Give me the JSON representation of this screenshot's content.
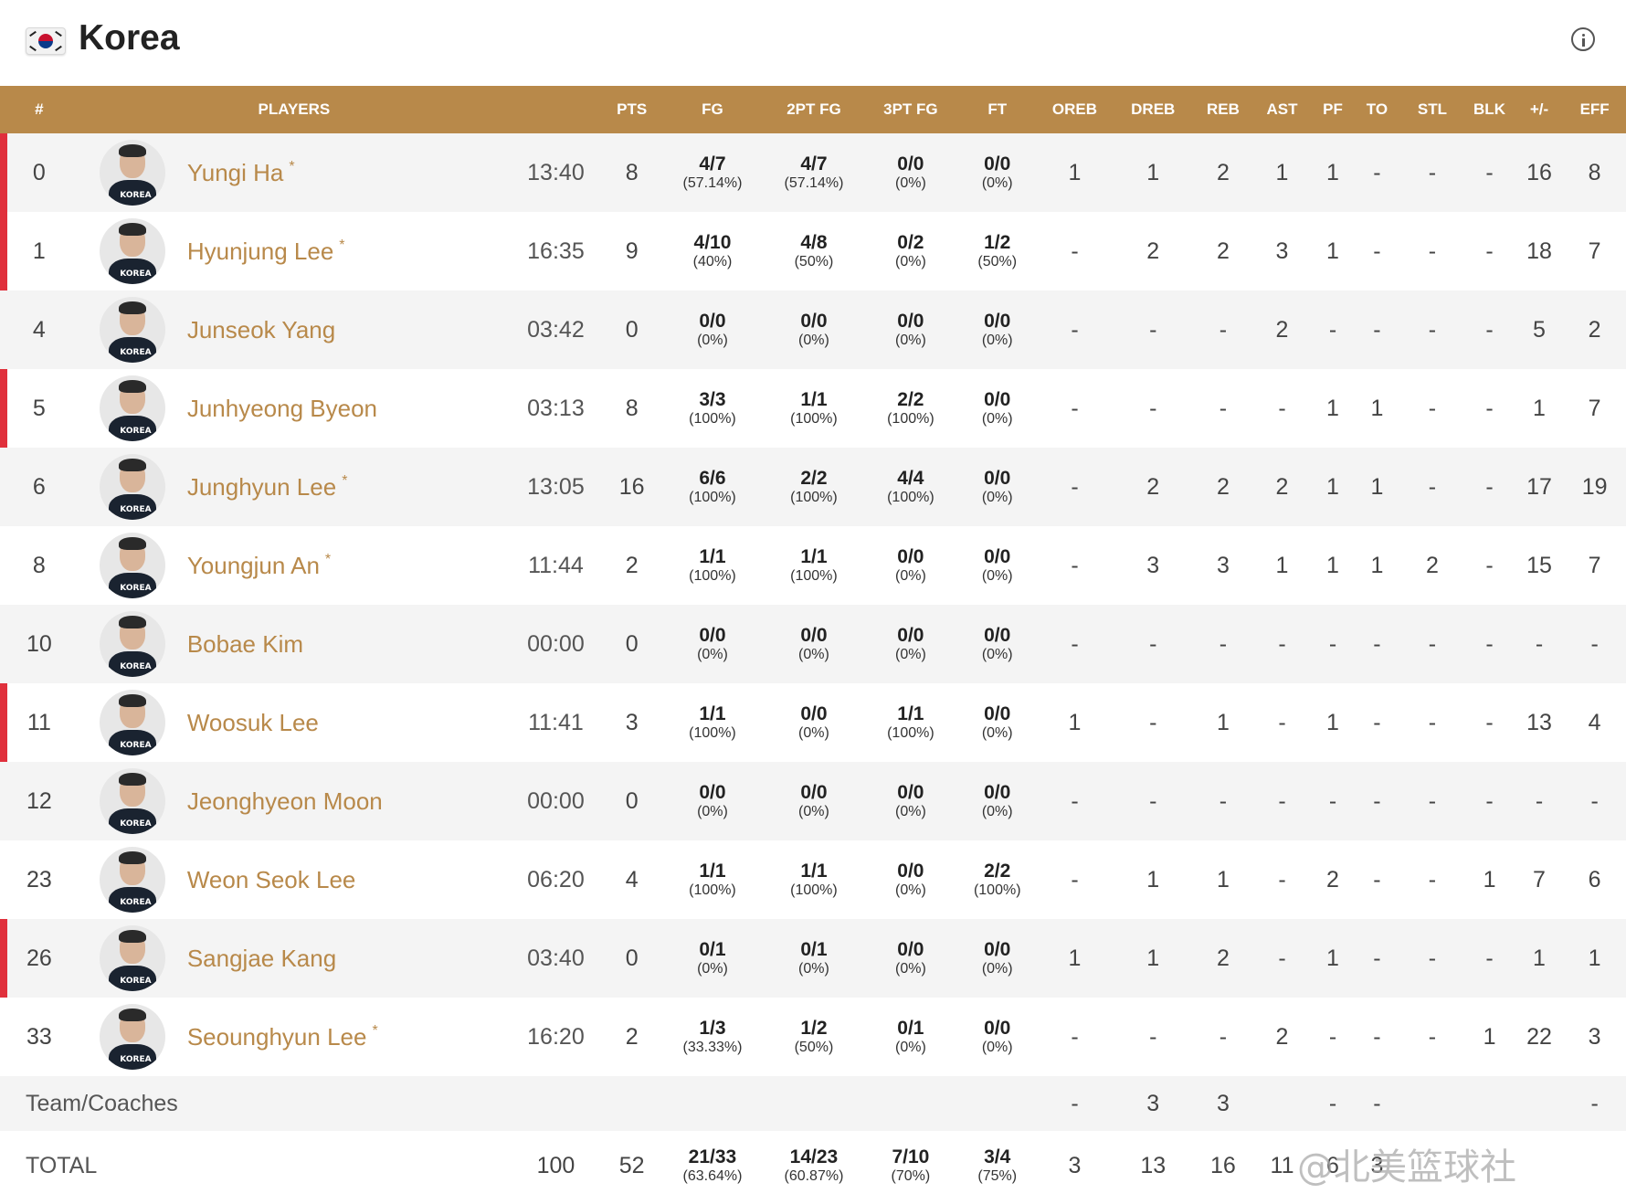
{
  "header": {
    "country": "Korea",
    "flag_icon": "south-korea-flag-icon",
    "info_icon": "info-icon"
  },
  "columns": [
    "#",
    "PLAYERS",
    "",
    "PTS",
    "FG",
    "2PT FG",
    "3PT FG",
    "FT",
    "OREB",
    "DREB",
    "REB",
    "AST",
    "PF",
    "TO",
    "STL",
    "BLK",
    "+/-",
    "EFF"
  ],
  "players": [
    {
      "num": "0",
      "name": "Yungi Ha",
      "starter": true,
      "min": "13:40",
      "pts": "8",
      "fg": [
        "4/7",
        "(57.14%)"
      ],
      "fg2": [
        "4/7",
        "(57.14%)"
      ],
      "fg3": [
        "0/0",
        "(0%)"
      ],
      "ft": [
        "0/0",
        "(0%)"
      ],
      "oreb": "1",
      "dreb": "1",
      "reb": "2",
      "ast": "1",
      "pf": "1",
      "to": "-",
      "stl": "-",
      "blk": "-",
      "pm": "16",
      "eff": "8"
    },
    {
      "num": "1",
      "name": "Hyunjung Lee",
      "starter": true,
      "min": "16:35",
      "pts": "9",
      "fg": [
        "4/10",
        "(40%)"
      ],
      "fg2": [
        "4/8",
        "(50%)"
      ],
      "fg3": [
        "0/2",
        "(0%)"
      ],
      "ft": [
        "1/2",
        "(50%)"
      ],
      "oreb": "-",
      "dreb": "2",
      "reb": "2",
      "ast": "3",
      "pf": "1",
      "to": "-",
      "stl": "-",
      "blk": "-",
      "pm": "18",
      "eff": "7"
    },
    {
      "num": "4",
      "name": "Junseok Yang",
      "starter": false,
      "min": "03:42",
      "pts": "0",
      "fg": [
        "0/0",
        "(0%)"
      ],
      "fg2": [
        "0/0",
        "(0%)"
      ],
      "fg3": [
        "0/0",
        "(0%)"
      ],
      "ft": [
        "0/0",
        "(0%)"
      ],
      "oreb": "-",
      "dreb": "-",
      "reb": "-",
      "ast": "2",
      "pf": "-",
      "to": "-",
      "stl": "-",
      "blk": "-",
      "pm": "5",
      "eff": "2"
    },
    {
      "num": "5",
      "name": "Junhyeong Byeon",
      "starter": false,
      "min": "03:13",
      "pts": "8",
      "fg": [
        "3/3",
        "(100%)"
      ],
      "fg2": [
        "1/1",
        "(100%)"
      ],
      "fg3": [
        "2/2",
        "(100%)"
      ],
      "ft": [
        "0/0",
        "(0%)"
      ],
      "oreb": "-",
      "dreb": "-",
      "reb": "-",
      "ast": "-",
      "pf": "1",
      "to": "1",
      "stl": "-",
      "blk": "-",
      "pm": "1",
      "eff": "7"
    },
    {
      "num": "6",
      "name": "Junghyun Lee",
      "starter": true,
      "min": "13:05",
      "pts": "16",
      "fg": [
        "6/6",
        "(100%)"
      ],
      "fg2": [
        "2/2",
        "(100%)"
      ],
      "fg3": [
        "4/4",
        "(100%)"
      ],
      "ft": [
        "0/0",
        "(0%)"
      ],
      "oreb": "-",
      "dreb": "2",
      "reb": "2",
      "ast": "2",
      "pf": "1",
      "to": "1",
      "stl": "-",
      "blk": "-",
      "pm": "17",
      "eff": "19"
    },
    {
      "num": "8",
      "name": "Youngjun An",
      "starter": true,
      "min": "11:44",
      "pts": "2",
      "fg": [
        "1/1",
        "(100%)"
      ],
      "fg2": [
        "1/1",
        "(100%)"
      ],
      "fg3": [
        "0/0",
        "(0%)"
      ],
      "ft": [
        "0/0",
        "(0%)"
      ],
      "oreb": "-",
      "dreb": "3",
      "reb": "3",
      "ast": "1",
      "pf": "1",
      "to": "1",
      "stl": "2",
      "blk": "-",
      "pm": "15",
      "eff": "7"
    },
    {
      "num": "10",
      "name": "Bobae Kim",
      "starter": false,
      "min": "00:00",
      "pts": "0",
      "fg": [
        "0/0",
        "(0%)"
      ],
      "fg2": [
        "0/0",
        "(0%)"
      ],
      "fg3": [
        "0/0",
        "(0%)"
      ],
      "ft": [
        "0/0",
        "(0%)"
      ],
      "oreb": "-",
      "dreb": "-",
      "reb": "-",
      "ast": "-",
      "pf": "-",
      "to": "-",
      "stl": "-",
      "blk": "-",
      "pm": "-",
      "eff": "-"
    },
    {
      "num": "11",
      "name": "Woosuk Lee",
      "starter": false,
      "min": "11:41",
      "pts": "3",
      "fg": [
        "1/1",
        "(100%)"
      ],
      "fg2": [
        "0/0",
        "(0%)"
      ],
      "fg3": [
        "1/1",
        "(100%)"
      ],
      "ft": [
        "0/0",
        "(0%)"
      ],
      "oreb": "1",
      "dreb": "-",
      "reb": "1",
      "ast": "-",
      "pf": "1",
      "to": "-",
      "stl": "-",
      "blk": "-",
      "pm": "13",
      "eff": "4"
    },
    {
      "num": "12",
      "name": "Jeonghyeon Moon",
      "starter": false,
      "min": "00:00",
      "pts": "0",
      "fg": [
        "0/0",
        "(0%)"
      ],
      "fg2": [
        "0/0",
        "(0%)"
      ],
      "fg3": [
        "0/0",
        "(0%)"
      ],
      "ft": [
        "0/0",
        "(0%)"
      ],
      "oreb": "-",
      "dreb": "-",
      "reb": "-",
      "ast": "-",
      "pf": "-",
      "to": "-",
      "stl": "-",
      "blk": "-",
      "pm": "-",
      "eff": "-"
    },
    {
      "num": "23",
      "name": "Weon Seok Lee",
      "starter": false,
      "min": "06:20",
      "pts": "4",
      "fg": [
        "1/1",
        "(100%)"
      ],
      "fg2": [
        "1/1",
        "(100%)"
      ],
      "fg3": [
        "0/0",
        "(0%)"
      ],
      "ft": [
        "2/2",
        "(100%)"
      ],
      "oreb": "-",
      "dreb": "1",
      "reb": "1",
      "ast": "-",
      "pf": "2",
      "to": "-",
      "stl": "-",
      "blk": "1",
      "pm": "7",
      "eff": "6"
    },
    {
      "num": "26",
      "name": "Sangjae Kang",
      "starter": false,
      "min": "03:40",
      "pts": "0",
      "fg": [
        "0/1",
        "(0%)"
      ],
      "fg2": [
        "0/1",
        "(0%)"
      ],
      "fg3": [
        "0/0",
        "(0%)"
      ],
      "ft": [
        "0/0",
        "(0%)"
      ],
      "oreb": "1",
      "dreb": "1",
      "reb": "2",
      "ast": "-",
      "pf": "1",
      "to": "-",
      "stl": "-",
      "blk": "-",
      "pm": "1",
      "eff": "1"
    },
    {
      "num": "33",
      "name": "Seounghyun Lee",
      "starter": true,
      "min": "16:20",
      "pts": "2",
      "fg": [
        "1/3",
        "(33.33%)"
      ],
      "fg2": [
        "1/2",
        "(50%)"
      ],
      "fg3": [
        "0/1",
        "(0%)"
      ],
      "ft": [
        "0/0",
        "(0%)"
      ],
      "oreb": "-",
      "dreb": "-",
      "reb": "-",
      "ast": "2",
      "pf": "-",
      "to": "-",
      "stl": "-",
      "blk": "1",
      "pm": "22",
      "eff": "3"
    }
  ],
  "red_bar_rows": [
    "0",
    "1",
    "5",
    "11",
    "26"
  ],
  "team": {
    "label": "Team/Coaches",
    "oreb": "-",
    "dreb": "3",
    "reb": "3",
    "ast": "",
    "pf": "-",
    "to": "-",
    "stl": "",
    "blk": "",
    "pm": "",
    "eff": "-"
  },
  "total": {
    "label": "TOTAL",
    "min": "100",
    "pts": "52",
    "fg": [
      "21/33",
      "(63.64%)"
    ],
    "fg2": [
      "14/23",
      "(60.87%)"
    ],
    "fg3": [
      "7/10",
      "(70%)"
    ],
    "ft": [
      "3/4",
      "(75%)"
    ],
    "oreb": "3",
    "dreb": "13",
    "reb": "16",
    "ast": "11",
    "pf": "6",
    "to": "3"
  },
  "watermark": "@北美篮球社",
  "colors": {
    "header_bg": "#b8894a",
    "name": "#b8894a",
    "starter_bar": "#e0303c"
  }
}
